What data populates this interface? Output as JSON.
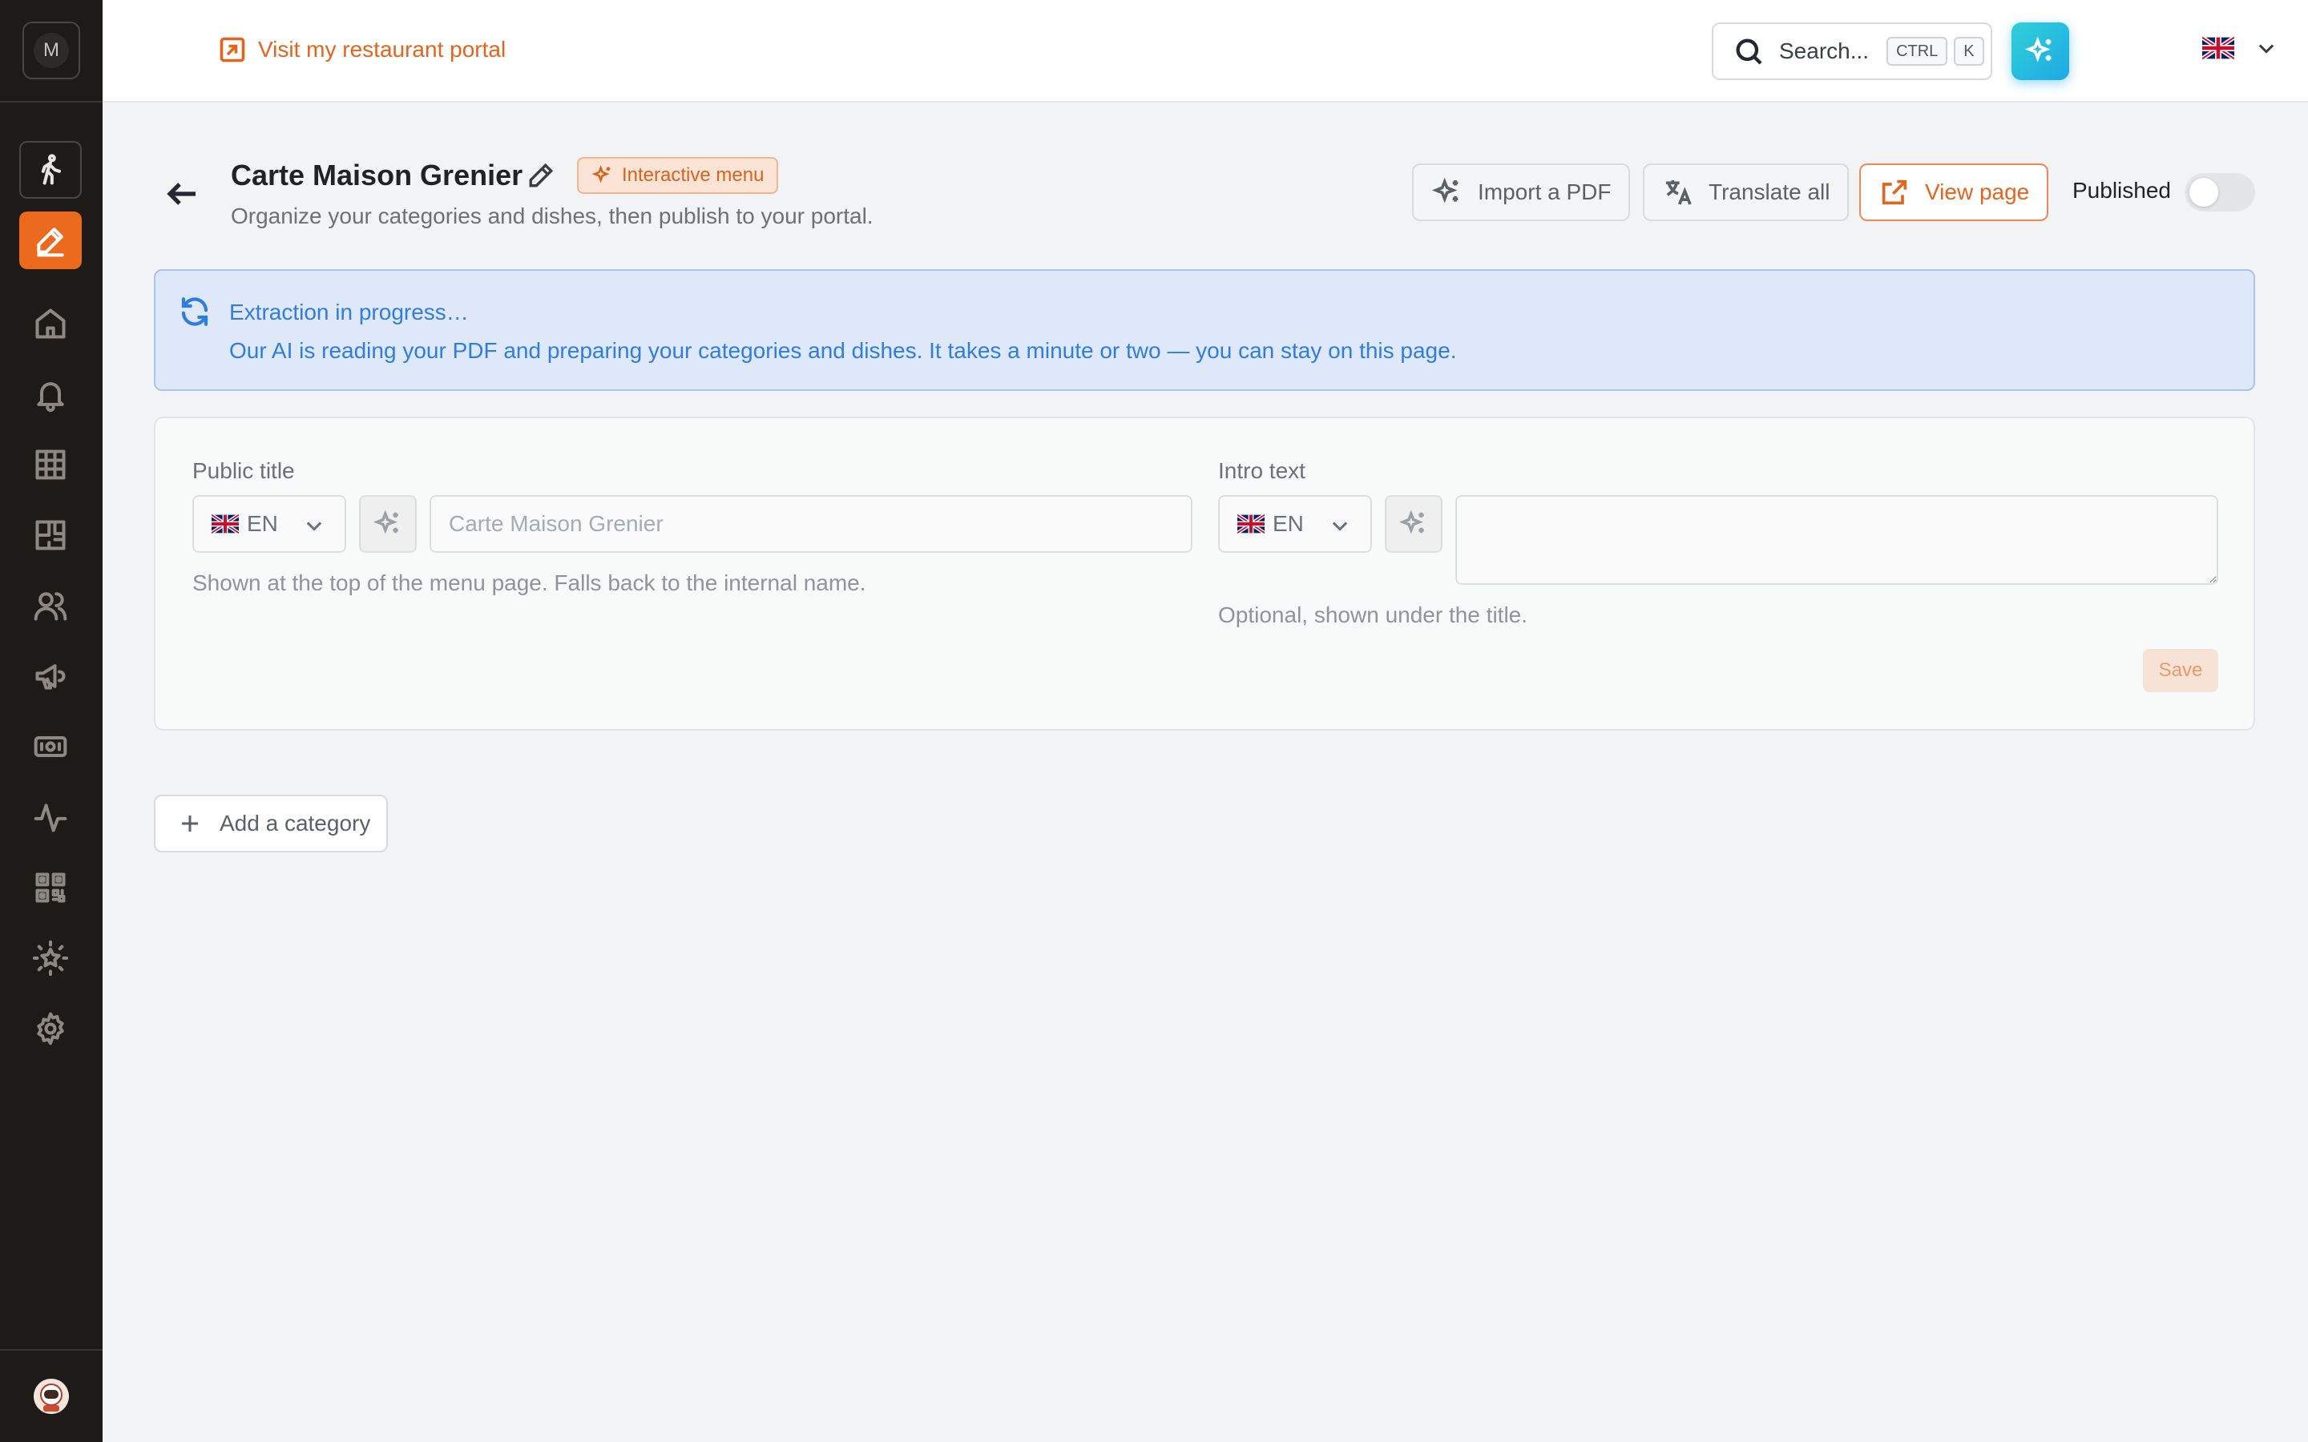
{
  "sidebar": {
    "logo_letter": "M",
    "items": [
      {
        "name": "walking-person-icon"
      },
      {
        "name": "pen-icon",
        "active": true
      },
      {
        "name": "home-icon"
      },
      {
        "name": "bell-icon"
      },
      {
        "name": "table-grid-icon"
      },
      {
        "name": "floor-plan-icon"
      },
      {
        "name": "users-icon"
      },
      {
        "name": "megaphone-icon"
      },
      {
        "name": "cash-icon"
      },
      {
        "name": "activity-icon"
      },
      {
        "name": "qr-code-icon"
      },
      {
        "name": "star-badge-icon"
      },
      {
        "name": "gear-icon"
      }
    ]
  },
  "topbar": {
    "portal_link": "Visit my restaurant portal",
    "search": {
      "placeholder": "Search...",
      "shortcut_keys": [
        "CTRL",
        "K"
      ]
    },
    "language_flag": "uk-flag-icon"
  },
  "header": {
    "title": "Carte Maison Grenier",
    "badge": "Interactive menu",
    "subtitle": "Organize your categories and dishes, then publish to your portal.",
    "buttons": {
      "import_pdf": "Import a PDF",
      "translate_all": "Translate all",
      "view_page": "View page"
    },
    "published_label": "Published",
    "published": false
  },
  "alert": {
    "title": "Extraction in progress…",
    "body": "Our AI is reading your PDF and preparing your categories and dishes. It takes a minute or two — you can stay on this page."
  },
  "form": {
    "public_title": {
      "label": "Public title",
      "lang": "EN",
      "value": "",
      "placeholder": "Carte Maison Grenier",
      "help": "Shown at the top of the menu page. Falls back to the internal name."
    },
    "intro_text": {
      "label": "Intro text",
      "lang": "EN",
      "value": "",
      "help": "Optional, shown under the title."
    },
    "save_label": "Save"
  },
  "add_category_label": "Add a category",
  "colors": {
    "accent": "#ec6a1e",
    "sidebar_bg": "#1e1a17",
    "info": "#2f7de1",
    "ai_gradient_start": "#2fd0d8",
    "ai_gradient_end": "#1fa9e6"
  }
}
